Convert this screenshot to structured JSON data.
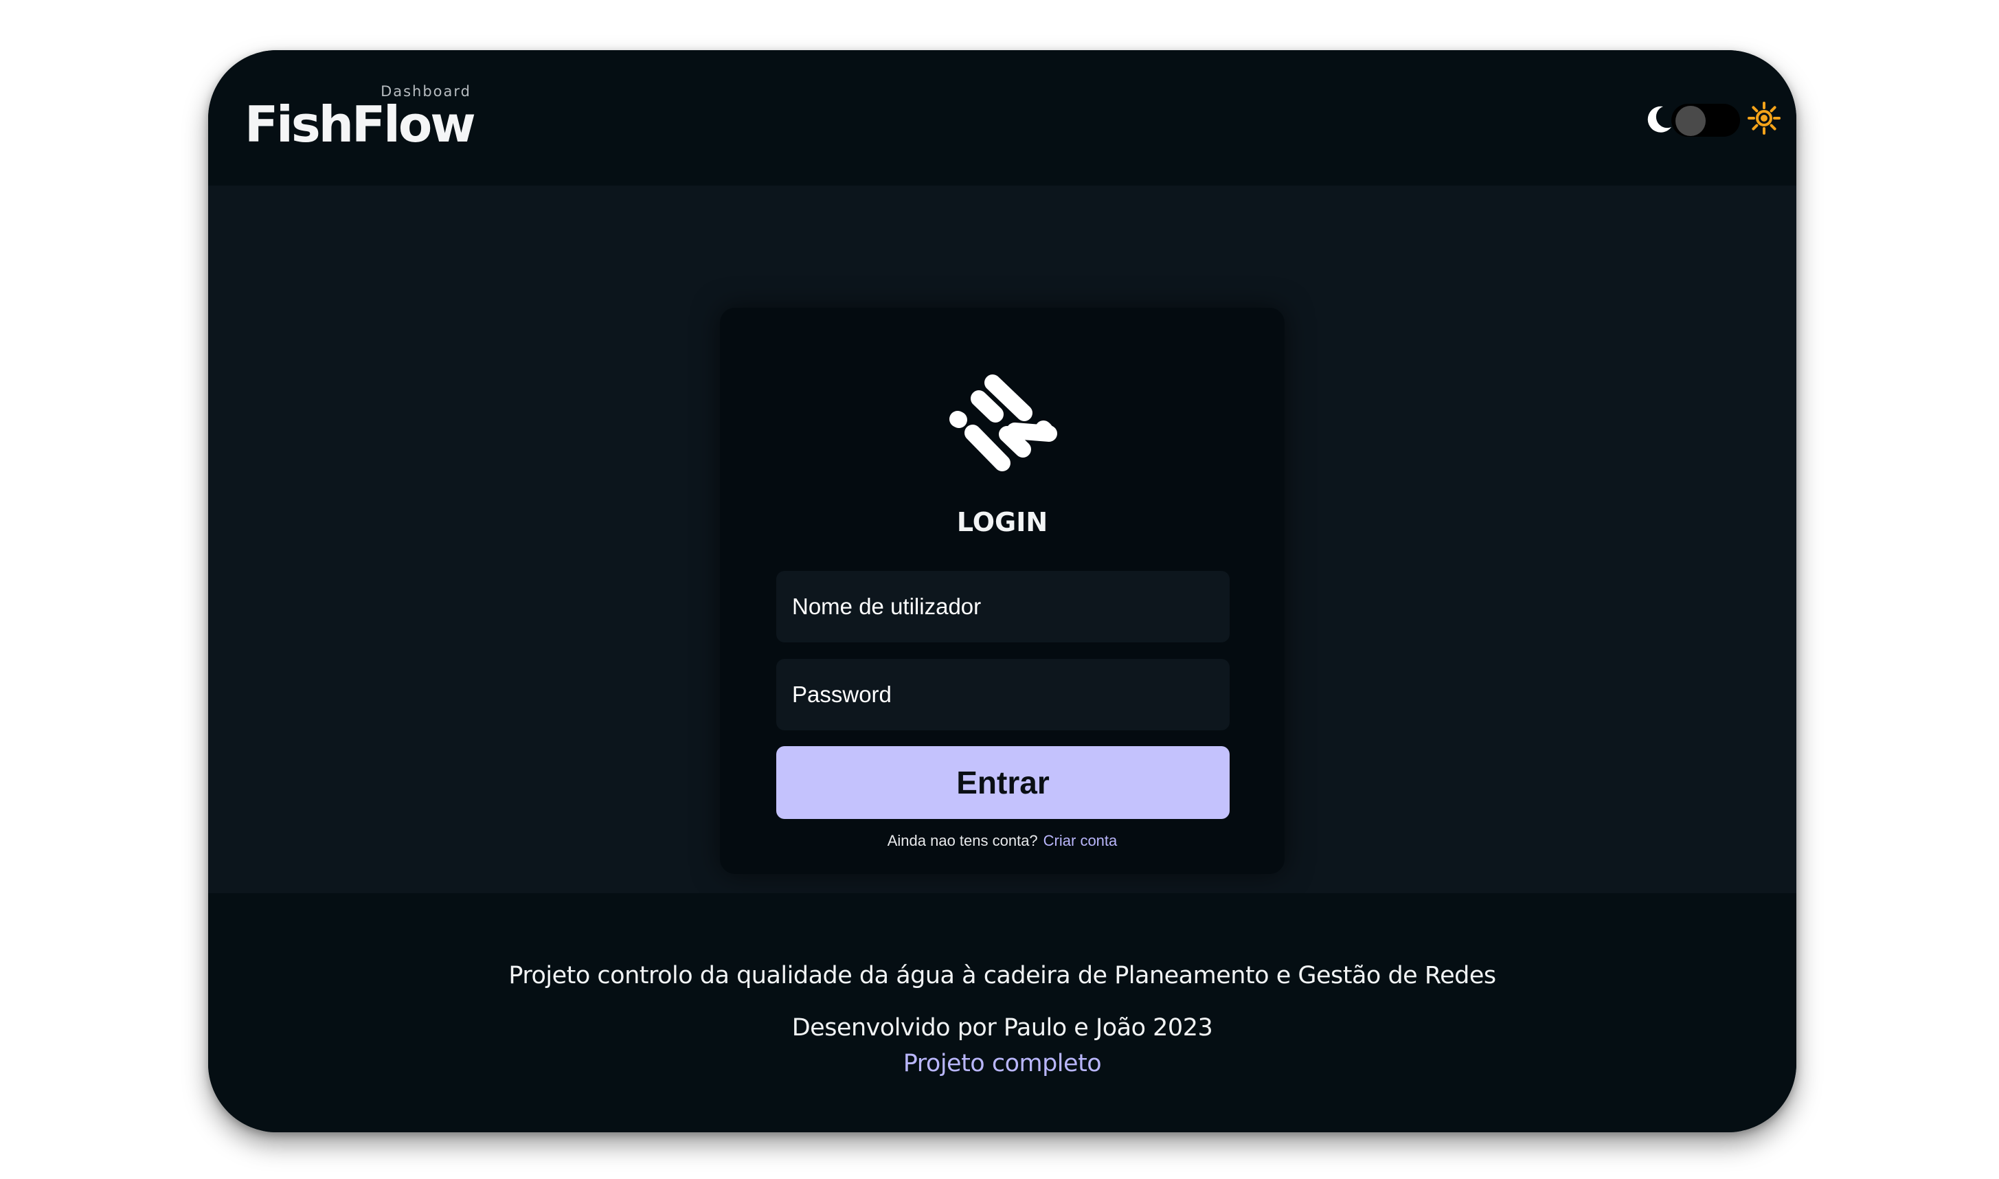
{
  "header": {
    "brand_name": "FishFlow",
    "brand_subtitle": "Dashboard",
    "theme_toggle": {
      "left_icon": "moon-icon",
      "right_icon": "sun-icon",
      "state": "dark"
    }
  },
  "login": {
    "logo_icon": "fishflow-logo-icon",
    "title": "LOGIN",
    "username_placeholder": "Nome de utilizador",
    "username_value": "",
    "password_placeholder": "Password",
    "password_value": "",
    "submit_label": "Entrar",
    "signup_prompt": "Ainda nao tens conta?",
    "signup_link": "Criar conta"
  },
  "footer": {
    "description": "Projeto controlo da qualidade da água à cadeira de Planeamento e Gestão de Redes",
    "credits": "Desenvolvido por Paulo e João 2023",
    "project_link": "Projeto completo"
  },
  "colors": {
    "background": "#050e13",
    "main_background": "#0c151c",
    "card_background": "#040b10",
    "input_background": "#0d161d",
    "accent": "#c4c2fd",
    "link": "#b9b6fb",
    "sun": "#f5a31a"
  }
}
